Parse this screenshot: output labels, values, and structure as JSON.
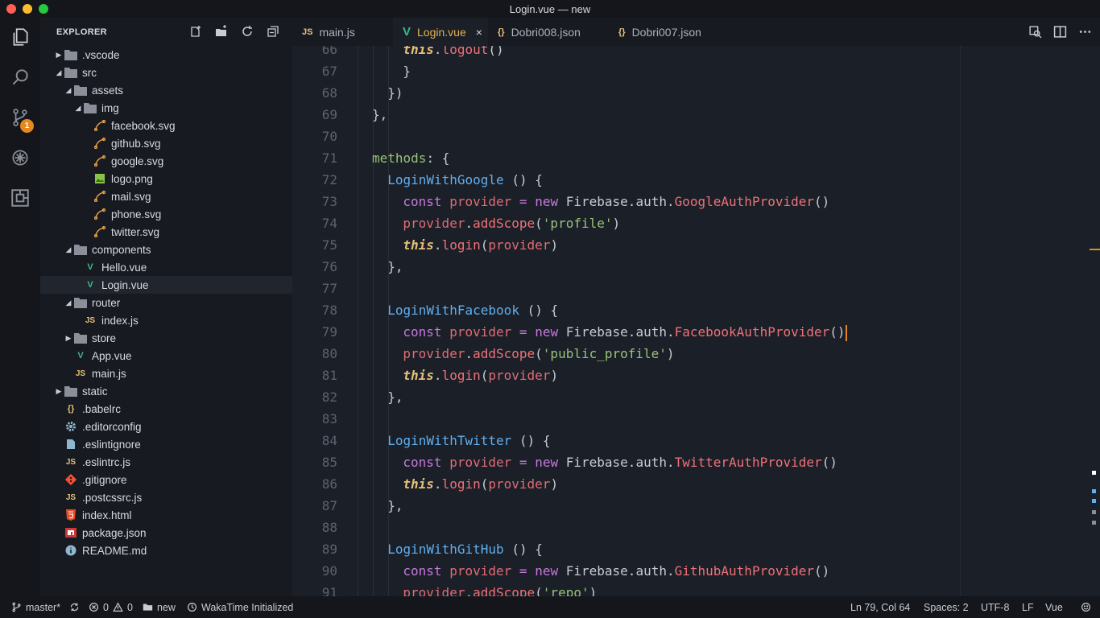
{
  "window": {
    "title": "Login.vue — new"
  },
  "sidebar": {
    "title": "EXPLORER",
    "items": [
      {
        "label": ".vscode",
        "kind": "folder",
        "depth": 0,
        "expanded": false
      },
      {
        "label": "src",
        "kind": "folder",
        "depth": 0,
        "expanded": true
      },
      {
        "label": "assets",
        "kind": "folder",
        "depth": 1,
        "expanded": true
      },
      {
        "label": "img",
        "kind": "folder",
        "depth": 2,
        "expanded": true
      },
      {
        "label": "facebook.svg",
        "kind": "svg",
        "depth": 3
      },
      {
        "label": "github.svg",
        "kind": "svg",
        "depth": 3
      },
      {
        "label": "google.svg",
        "kind": "svg",
        "depth": 3
      },
      {
        "label": "logo.png",
        "kind": "png",
        "depth": 3
      },
      {
        "label": "mail.svg",
        "kind": "svg",
        "depth": 3
      },
      {
        "label": "phone.svg",
        "kind": "svg",
        "depth": 3
      },
      {
        "label": "twitter.svg",
        "kind": "svg",
        "depth": 3
      },
      {
        "label": "components",
        "kind": "folder",
        "depth": 1,
        "expanded": true
      },
      {
        "label": "Hello.vue",
        "kind": "vue",
        "depth": 2
      },
      {
        "label": "Login.vue",
        "kind": "vue",
        "depth": 2,
        "selected": true
      },
      {
        "label": "router",
        "kind": "folder",
        "depth": 1,
        "expanded": true
      },
      {
        "label": "index.js",
        "kind": "js",
        "depth": 2
      },
      {
        "label": "store",
        "kind": "folder",
        "depth": 1,
        "expanded": false
      },
      {
        "label": "App.vue",
        "kind": "vue",
        "depth": 1
      },
      {
        "label": "main.js",
        "kind": "js",
        "depth": 1
      },
      {
        "label": "static",
        "kind": "folder",
        "depth": 0,
        "expanded": false
      },
      {
        "label": ".babelrc",
        "kind": "json",
        "depth": 0
      },
      {
        "label": ".editorconfig",
        "kind": "gear",
        "depth": 0
      },
      {
        "label": ".eslintignore",
        "kind": "doc",
        "depth": 0
      },
      {
        "label": ".eslintrc.js",
        "kind": "js",
        "depth": 0
      },
      {
        "label": ".gitignore",
        "kind": "git",
        "depth": 0
      },
      {
        "label": ".postcssrc.js",
        "kind": "js",
        "depth": 0
      },
      {
        "label": "index.html",
        "kind": "html",
        "depth": 0
      },
      {
        "label": "package.json",
        "kind": "npm",
        "depth": 0
      },
      {
        "label": "README.md",
        "kind": "info",
        "depth": 0
      }
    ]
  },
  "activity": {
    "scm_badge": "1"
  },
  "tabs": [
    {
      "label": "main.js",
      "icon_text": "JS",
      "kind": "js",
      "active": false
    },
    {
      "label": "Login.vue",
      "icon_text": "V",
      "kind": "vue",
      "active": true
    },
    {
      "label": "Dobri008.json",
      "icon_text": "{}",
      "kind": "json",
      "active": false
    },
    {
      "label": "Dobri007.json",
      "icon_text": "{}",
      "kind": "json",
      "active": false
    }
  ],
  "tab_close_glyph": "×",
  "icon_text": {
    "js": "JS",
    "json": "{}",
    "vue": "V"
  },
  "editor": {
    "lines": [
      {
        "n": "66",
        "indent": 2,
        "tokens": [
          [
            "this",
            "this"
          ],
          [
            "punc",
            "."
          ],
          [
            "mfn",
            "logout"
          ],
          [
            "punc",
            "()"
          ]
        ]
      },
      {
        "n": "67",
        "indent": 2,
        "tokens": [
          [
            "punc",
            "}"
          ]
        ]
      },
      {
        "n": "68",
        "indent": 1,
        "tokens": [
          [
            "punc",
            "})"
          ]
        ]
      },
      {
        "n": "69",
        "indent": 0,
        "tokens": [
          [
            "punc",
            "},"
          ]
        ]
      },
      {
        "n": "70",
        "indent": 0,
        "tokens": []
      },
      {
        "n": "71",
        "indent": 0,
        "tokens": [
          [
            "key",
            "methods"
          ],
          [
            "punc",
            ": {"
          ]
        ]
      },
      {
        "n": "72",
        "indent": 1,
        "tokens": [
          [
            "fn",
            "LoginWithGoogle"
          ],
          [
            "punc",
            " () {"
          ]
        ]
      },
      {
        "n": "73",
        "indent": 2,
        "tokens": [
          [
            "kw",
            "const"
          ],
          [
            "punc",
            " "
          ],
          [
            "var",
            "provider"
          ],
          [
            "punc",
            " "
          ],
          [
            "kw",
            "="
          ],
          [
            "punc",
            " "
          ],
          [
            "kw",
            "new"
          ],
          [
            "punc",
            " "
          ],
          [
            "cls",
            "Firebase"
          ],
          [
            "punc",
            "."
          ],
          [
            "cls",
            "auth"
          ],
          [
            "punc",
            "."
          ],
          [
            "mfn",
            "GoogleAuthProvider"
          ],
          [
            "punc",
            "()"
          ]
        ]
      },
      {
        "n": "74",
        "indent": 2,
        "tokens": [
          [
            "var",
            "provider"
          ],
          [
            "punc",
            "."
          ],
          [
            "mfn",
            "addScope"
          ],
          [
            "punc",
            "("
          ],
          [
            "str",
            "'profile'"
          ],
          [
            "punc",
            ")"
          ]
        ]
      },
      {
        "n": "75",
        "indent": 2,
        "tokens": [
          [
            "this",
            "this"
          ],
          [
            "punc",
            "."
          ],
          [
            "mfn",
            "login"
          ],
          [
            "punc",
            "("
          ],
          [
            "var",
            "provider"
          ],
          [
            "punc",
            ")"
          ]
        ]
      },
      {
        "n": "76",
        "indent": 1,
        "tokens": [
          [
            "punc",
            "},"
          ]
        ]
      },
      {
        "n": "77",
        "indent": 0,
        "tokens": []
      },
      {
        "n": "78",
        "indent": 1,
        "tokens": [
          [
            "fn",
            "LoginWithFacebook"
          ],
          [
            "punc",
            " () {"
          ]
        ]
      },
      {
        "n": "79",
        "indent": 2,
        "cursor": true,
        "tokens": [
          [
            "kw",
            "const"
          ],
          [
            "punc",
            " "
          ],
          [
            "var",
            "provider"
          ],
          [
            "punc",
            " "
          ],
          [
            "kw",
            "="
          ],
          [
            "punc",
            " "
          ],
          [
            "kw",
            "new"
          ],
          [
            "punc",
            " "
          ],
          [
            "cls",
            "Firebase"
          ],
          [
            "punc",
            "."
          ],
          [
            "cls",
            "auth"
          ],
          [
            "punc",
            "."
          ],
          [
            "mfn",
            "FacebookAuthProvider"
          ],
          [
            "punc",
            "()"
          ]
        ]
      },
      {
        "n": "80",
        "indent": 2,
        "tokens": [
          [
            "var",
            "provider"
          ],
          [
            "punc",
            "."
          ],
          [
            "mfn",
            "addScope"
          ],
          [
            "punc",
            "("
          ],
          [
            "str",
            "'public_profile'"
          ],
          [
            "punc",
            ")"
          ]
        ]
      },
      {
        "n": "81",
        "indent": 2,
        "tokens": [
          [
            "this",
            "this"
          ],
          [
            "punc",
            "."
          ],
          [
            "mfn",
            "login"
          ],
          [
            "punc",
            "("
          ],
          [
            "var",
            "provider"
          ],
          [
            "punc",
            ")"
          ]
        ]
      },
      {
        "n": "82",
        "indent": 1,
        "tokens": [
          [
            "punc",
            "},"
          ]
        ]
      },
      {
        "n": "83",
        "indent": 0,
        "tokens": []
      },
      {
        "n": "84",
        "indent": 1,
        "tokens": [
          [
            "fn",
            "LoginWithTwitter"
          ],
          [
            "punc",
            " () {"
          ]
        ]
      },
      {
        "n": "85",
        "indent": 2,
        "tokens": [
          [
            "kw",
            "const"
          ],
          [
            "punc",
            " "
          ],
          [
            "var",
            "provider"
          ],
          [
            "punc",
            " "
          ],
          [
            "kw",
            "="
          ],
          [
            "punc",
            " "
          ],
          [
            "kw",
            "new"
          ],
          [
            "punc",
            " "
          ],
          [
            "cls",
            "Firebase"
          ],
          [
            "punc",
            "."
          ],
          [
            "cls",
            "auth"
          ],
          [
            "punc",
            "."
          ],
          [
            "mfn",
            "TwitterAuthProvider"
          ],
          [
            "punc",
            "()"
          ]
        ]
      },
      {
        "n": "86",
        "indent": 2,
        "tokens": [
          [
            "this",
            "this"
          ],
          [
            "punc",
            "."
          ],
          [
            "mfn",
            "login"
          ],
          [
            "punc",
            "("
          ],
          [
            "var",
            "provider"
          ],
          [
            "punc",
            ")"
          ]
        ]
      },
      {
        "n": "87",
        "indent": 1,
        "tokens": [
          [
            "punc",
            "},"
          ]
        ]
      },
      {
        "n": "88",
        "indent": 0,
        "tokens": []
      },
      {
        "n": "89",
        "indent": 1,
        "tokens": [
          [
            "fn",
            "LoginWithGitHub"
          ],
          [
            "punc",
            " () {"
          ]
        ]
      },
      {
        "n": "90",
        "indent": 2,
        "tokens": [
          [
            "kw",
            "const"
          ],
          [
            "punc",
            " "
          ],
          [
            "var",
            "provider"
          ],
          [
            "punc",
            " "
          ],
          [
            "kw",
            "="
          ],
          [
            "punc",
            " "
          ],
          [
            "kw",
            "new"
          ],
          [
            "punc",
            " "
          ],
          [
            "cls",
            "Firebase"
          ],
          [
            "punc",
            "."
          ],
          [
            "cls",
            "auth"
          ],
          [
            "punc",
            "."
          ],
          [
            "mfn",
            "GithubAuthProvider"
          ],
          [
            "punc",
            "()"
          ]
        ]
      },
      {
        "n": "91",
        "indent": 2,
        "tokens": [
          [
            "var",
            "provider"
          ],
          [
            "punc",
            "."
          ],
          [
            "mfn",
            "addScope"
          ],
          [
            "punc",
            "("
          ],
          [
            "str",
            "'repo'"
          ],
          [
            "punc",
            ")"
          ]
        ]
      }
    ]
  },
  "statusbar": {
    "branch": "master*",
    "errors": "0",
    "warnings": "0",
    "folder": "new",
    "wakatime": "WakaTime Initialized",
    "position": "Ln 79, Col 64",
    "spaces": "Spaces: 2",
    "encoding": "UTF-8",
    "eol": "LF",
    "language": "Vue"
  },
  "colors": {
    "accent": "#e5881f",
    "vue": "#41b883",
    "js": "#e5c07b",
    "folder": "#8a8f99",
    "svg_icon": "#e5a04a"
  }
}
